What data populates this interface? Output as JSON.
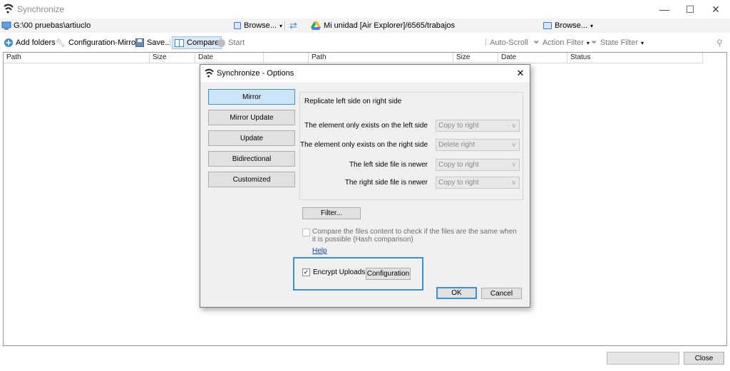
{
  "window": {
    "title": "Synchronize"
  },
  "paths": {
    "left_path": "G:\\00 pruebas\\artiuclo",
    "right_path": "Mi unidad [Air Explorer]/6565/trabajos",
    "browse_label": "Browse..."
  },
  "toolbar": {
    "add_folders": "Add folders",
    "configuration_mirror": "Configuration-Mirror",
    "save": "Save...",
    "compare": "Compare",
    "start": "Start",
    "auto_scroll": "Auto-Scroll",
    "action_filter": "Action Filter",
    "state_filter": "State Filter"
  },
  "grid": {
    "left_columns": [
      "Path",
      "Size",
      "Date"
    ],
    "right_columns": [
      "Path",
      "Size",
      "Date",
      "Status"
    ]
  },
  "bottom": {
    "close_label": "Close"
  },
  "dialog": {
    "title": "Synchronize - Options",
    "modes": [
      "Mirror",
      "Mirror Update",
      "Update",
      "Bidirectional",
      "Customized"
    ],
    "active_mode": "Mirror",
    "description": "Replicate left side on right side",
    "rules": [
      {
        "label": "The element only exists on the left side",
        "value": "Copy to right"
      },
      {
        "label": "The element only exists on the right side",
        "value": "Delete right"
      },
      {
        "label": "The left side file is newer",
        "value": "Copy to right"
      },
      {
        "label": "The right side file is newer",
        "value": "Copy to right"
      }
    ],
    "filter_label": "Filter...",
    "hash_compare_label": "Compare the files content to check if the files are the same when it is possible (Hash comparison)",
    "help_label": "Help",
    "encrypt_label": "Encrypt Uploads",
    "encrypt_checked": true,
    "configuration_label": "Configuration",
    "ok_label": "OK",
    "cancel_label": "Cancel"
  },
  "colors": {
    "accent": "#3c8fd4",
    "active_mode_bg": "#cce4f7",
    "link": "#0645ad"
  }
}
